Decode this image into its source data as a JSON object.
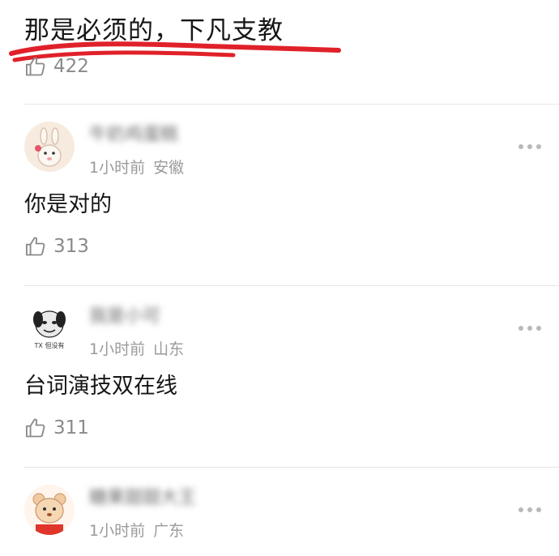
{
  "top_comment": {
    "text": "那是必须的，下凡支教",
    "likes": "422",
    "underline_color": "#e0212a"
  },
  "comments": [
    {
      "username": "牛奶鸡蛋糕",
      "time": "1小时前",
      "location": "安徽",
      "text": "你是对的",
      "likes": "313",
      "avatar": "cartoon-rabbit-avatar"
    },
    {
      "username": "我是小可",
      "time": "1小时前",
      "location": "山东",
      "text": "台词演技双在线",
      "likes": "311",
      "avatar": "meme-face-avatar",
      "avatar_caption": "TX 但没有"
    },
    {
      "username": "糖果甜甜大王",
      "time": "1小时前",
      "location": "广东",
      "avatar": "cartoon-bear-avatar"
    }
  ],
  "icons": {
    "like": "thumbs-up-icon",
    "more": "more-dots-icon"
  }
}
